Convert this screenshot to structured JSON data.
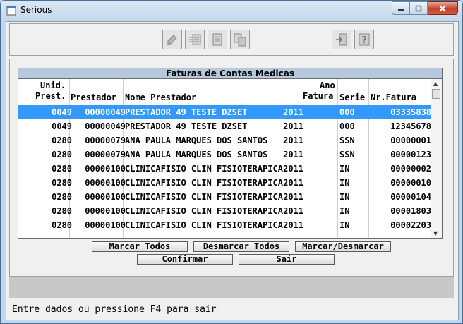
{
  "window": {
    "title": "Serious"
  },
  "grid": {
    "title": "Faturas de Contas Medicas",
    "headers": {
      "unid_1": "Unid.",
      "unid_2": "Prest.",
      "prestador": "Prestador",
      "nome": "Nome Prestador",
      "ano_1": "Ano",
      "ano_2": "Fatura",
      "serie": "Serie",
      "nr_fatura": "Nr.Fatura"
    },
    "rows": [
      {
        "unid": "0049",
        "prestador": "00000049",
        "nome": "PRESTADOR 49 TESTE DZSET",
        "ano": "2011",
        "serie": "000",
        "nr": "03335838",
        "selected": true
      },
      {
        "unid": "0049",
        "prestador": "00000049",
        "nome": "PRESTADOR 49 TESTE DZSET",
        "ano": "2011",
        "serie": "000",
        "nr": "12345678"
      },
      {
        "unid": "0280",
        "prestador": "00000079",
        "nome": "ANA PAULA MARQUES DOS SANTOS",
        "ano": "2011",
        "serie": "SSN",
        "nr": "00000001"
      },
      {
        "unid": "0280",
        "prestador": "00000079",
        "nome": "ANA PAULA MARQUES DOS SANTOS",
        "ano": "2011",
        "serie": "SSN",
        "nr": "00000123"
      },
      {
        "unid": "0280",
        "prestador": "00000100",
        "nome": "CLINICAFISIO CLIN FISIOTERAPICA",
        "ano": "2011",
        "serie": "IN",
        "nr": "00000002"
      },
      {
        "unid": "0280",
        "prestador": "00000100",
        "nome": "CLINICAFISIO CLIN FISIOTERAPICA",
        "ano": "2011",
        "serie": "IN",
        "nr": "00000010"
      },
      {
        "unid": "0280",
        "prestador": "00000100",
        "nome": "CLINICAFISIO CLIN FISIOTERAPICA",
        "ano": "2011",
        "serie": "IN",
        "nr": "00000104"
      },
      {
        "unid": "0280",
        "prestador": "00000100",
        "nome": "CLINICAFISIO CLIN FISIOTERAPICA",
        "ano": "2011",
        "serie": "IN",
        "nr": "00001803"
      },
      {
        "unid": "0280",
        "prestador": "00000100",
        "nome": "CLINICAFISIO CLIN FISIOTERAPICA",
        "ano": "2011",
        "serie": "IN",
        "nr": "00002203"
      }
    ]
  },
  "buttons": {
    "marcar_todos": "Marcar Todos",
    "desmarcar_todos": "Desmarcar Todos",
    "marcar_desmarcar": "Marcar/Desmarcar",
    "confirmar": "Confirmar",
    "sair": "Sair"
  },
  "toolbar": {
    "icons": [
      "edit-icon",
      "list-icon",
      "document-icon",
      "copy-icon",
      "exit-door-icon",
      "help-icon"
    ]
  },
  "status": {
    "message": "Entre dados ou pressione F4 para sair"
  },
  "colors": {
    "selection": "#3399ff",
    "grid_title_bg": "#b5c8dc",
    "close_button": "#c7422b"
  }
}
